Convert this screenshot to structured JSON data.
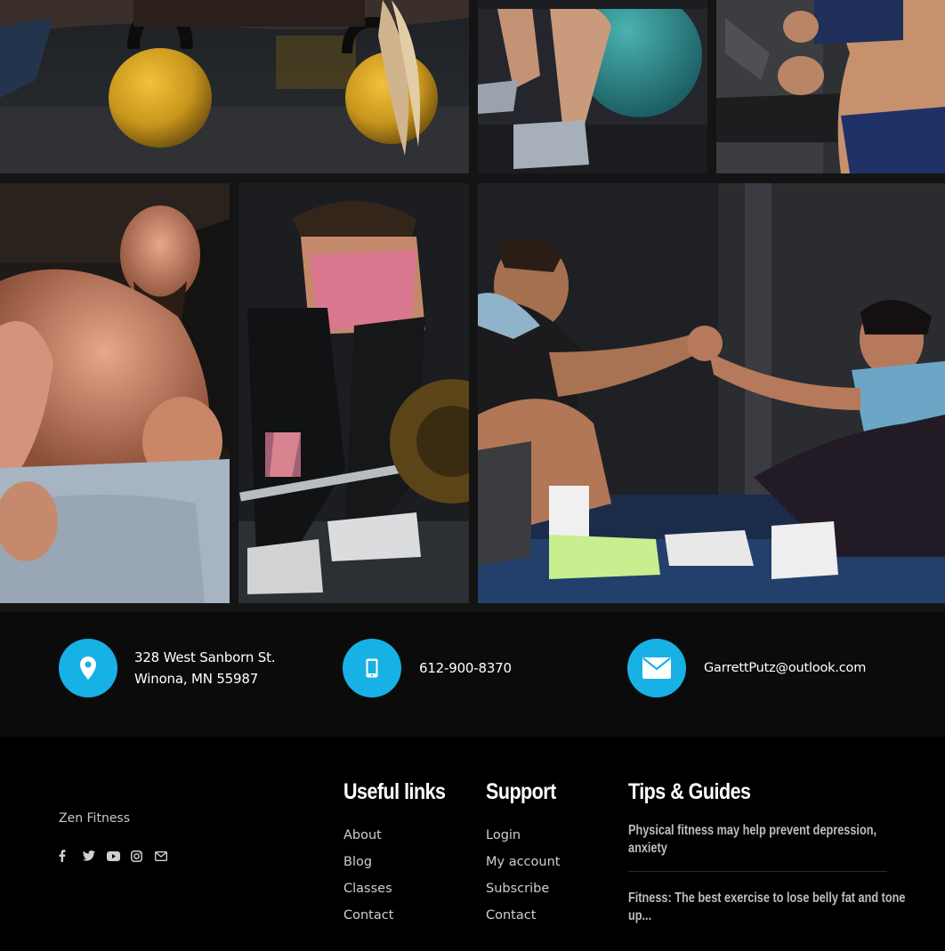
{
  "gallery": {
    "images": [
      {
        "name": "kettlebell-workout-photo"
      },
      {
        "name": "exercise-ball-photo"
      },
      {
        "name": "treadmill-runner-photo"
      },
      {
        "name": "bodybuilder-curl-photo"
      },
      {
        "name": "deadlift-woman-photo"
      },
      {
        "name": "partners-high-five-photo"
      }
    ]
  },
  "contact": {
    "address": "328 West Sanborn St. Winona, MN 55987",
    "phone": "612-900-8370",
    "email": "GarrettPutz@outlook.com",
    "accent_color": "#17b1e6"
  },
  "footer": {
    "brand": "Zen Fitness",
    "socials": [
      "facebook-icon",
      "twitter-icon",
      "youtube-icon",
      "instagram-icon",
      "envelope-icon"
    ],
    "useful_links": {
      "title": "Useful links",
      "items": [
        "About",
        "Blog",
        "Classes",
        "Contact"
      ]
    },
    "support": {
      "title": "Support",
      "items": [
        "Login",
        "My account",
        "Subscribe",
        "Contact"
      ]
    },
    "tips": {
      "title": "Tips & Guides",
      "items": [
        "Physical fitness may help prevent depression, anxiety",
        "Fitness: The best exercise to lose belly fat and tone up..."
      ]
    }
  }
}
